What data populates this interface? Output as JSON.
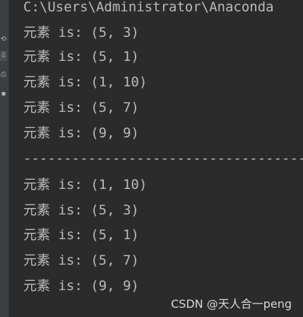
{
  "console": {
    "path_line": "C:\\Users\\Administrator\\Anaconda",
    "lines": [
      "元素 is: (5, 3)",
      "元素 is: (5, 1)",
      "元素 is: (1, 10)",
      "元素 is: (5, 7)",
      "元素 is: (9, 9)",
      "------------------------------------------",
      "元素 is: (1, 10)",
      "元素 is: (5, 3)",
      "元素 is: (5, 1)",
      "元素 is: (5, 7)",
      "元素 is: (9, 9)"
    ]
  },
  "watermark": "CSDN @天人合一peng",
  "colors": {
    "background": "#2b2b2b",
    "text": "#bbbbbb",
    "gutter": "#3c3f41"
  },
  "gutter_icons": [
    "rerun-icon",
    "scroll-to-end-icon",
    "print-icon",
    "delete-icon"
  ]
}
